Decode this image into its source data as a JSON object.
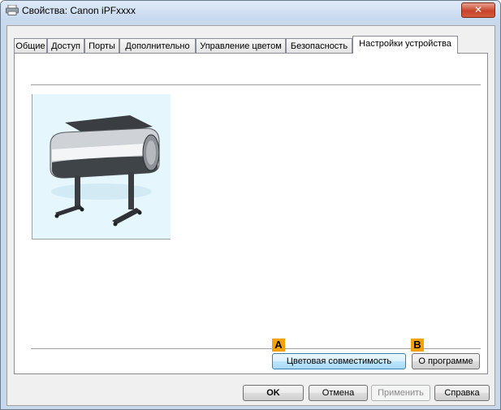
{
  "window": {
    "title": "Свойства: Canon iPFxxxx",
    "close_glyph": "✕"
  },
  "tabs": [
    {
      "label": "Общие"
    },
    {
      "label": "Доступ"
    },
    {
      "label": "Порты"
    },
    {
      "label": "Дополнительно"
    },
    {
      "label": "Управление цветом"
    },
    {
      "label": "Безопасность"
    },
    {
      "label": "Настройки устройства",
      "active": true
    }
  ],
  "device_page": {
    "color_compat_button": "Цветовая совместимость",
    "about_button": "О программе",
    "callout_a": "A",
    "callout_b": "B"
  },
  "footer": {
    "ok": "OK",
    "cancel": "Отмена",
    "apply": "Применить",
    "help": "Справка"
  },
  "colors": {
    "callout": "#f5a200",
    "printer_bg": "#e5f6fc"
  }
}
